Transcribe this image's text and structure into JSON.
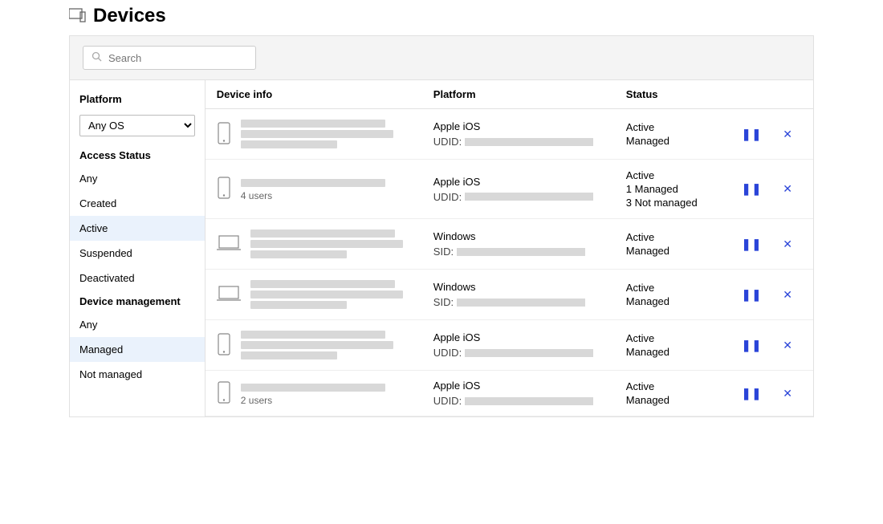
{
  "page_title": "Devices",
  "search": {
    "placeholder": "Search"
  },
  "filters": {
    "platform_label": "Platform",
    "platform_select_value": "Any OS",
    "access_status_label": "Access Status",
    "access_status_options": [
      "Any",
      "Created",
      "Active",
      "Suspended",
      "Deactivated"
    ],
    "access_status_active": "Active",
    "device_mgmt_label": "Device management",
    "device_mgmt_options": [
      "Any",
      "Managed",
      "Not managed"
    ],
    "device_mgmt_active": "Managed"
  },
  "columns": {
    "c1": "Device info",
    "c2": "Platform",
    "c3": "Status"
  },
  "rows": [
    {
      "device_type": "phone",
      "lines": 3,
      "users_text": "",
      "platform": "Apple iOS",
      "id_label": "UDID:",
      "status": [
        "Active",
        "Managed"
      ]
    },
    {
      "device_type": "phone",
      "lines": 1,
      "users_text": "4 users",
      "platform": "Apple iOS",
      "id_label": "UDID:",
      "status": [
        "Active",
        "1 Managed",
        "3 Not managed"
      ]
    },
    {
      "device_type": "laptop",
      "lines": 3,
      "users_text": "",
      "platform": "Windows",
      "id_label": "SID:",
      "status": [
        "Active",
        "Managed"
      ]
    },
    {
      "device_type": "laptop",
      "lines": 3,
      "users_text": "",
      "platform": "Windows",
      "id_label": "SID:",
      "status": [
        "Active",
        "Managed"
      ]
    },
    {
      "device_type": "phone",
      "lines": 3,
      "users_text": "",
      "platform": "Apple iOS",
      "id_label": "UDID:",
      "status": [
        "Active",
        "Managed"
      ]
    },
    {
      "device_type": "phone",
      "lines": 1,
      "users_text": "2 users",
      "platform": "Apple iOS",
      "id_label": "UDID:",
      "status": [
        "Active",
        "Managed"
      ]
    }
  ]
}
